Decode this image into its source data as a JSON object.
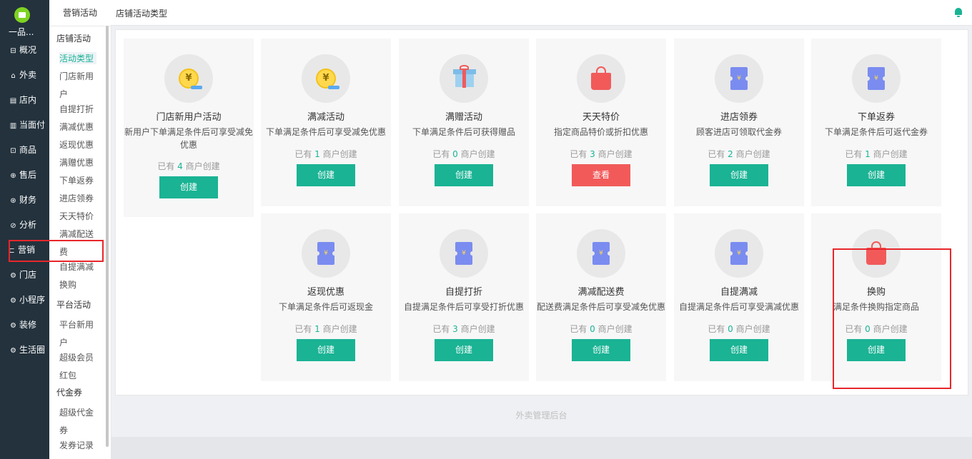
{
  "sidebar": {
    "logo_icon": "book-icon",
    "brand": "一品...",
    "items": [
      {
        "label": "概况",
        "icon": "dashboard-icon",
        "glyph": "⊟"
      },
      {
        "label": "外卖",
        "icon": "delivery-icon",
        "glyph": "⌂"
      },
      {
        "label": "店内",
        "icon": "store-icon",
        "glyph": "▤"
      },
      {
        "label": "当面付",
        "icon": "receipt-icon",
        "glyph": "▥"
      },
      {
        "label": "商品",
        "icon": "goods-icon",
        "glyph": "⊡"
      },
      {
        "label": "售后",
        "icon": "aftersale-icon",
        "glyph": "⊕"
      },
      {
        "label": "财务",
        "icon": "finance-icon",
        "glyph": "⊛"
      },
      {
        "label": "分析",
        "icon": "analysis-icon",
        "glyph": "⊘"
      },
      {
        "label": "营销",
        "icon": "marketing-icon",
        "glyph": "⊏"
      },
      {
        "label": "门店",
        "icon": "shop-icon",
        "glyph": "⚙"
      },
      {
        "label": "小程序",
        "icon": "miniapp-icon",
        "glyph": "⚙"
      },
      {
        "label": "装修",
        "icon": "decorate-icon",
        "glyph": "⚙"
      },
      {
        "label": "生活圈",
        "icon": "lifecircle-icon",
        "glyph": "⚙"
      }
    ]
  },
  "subnav": {
    "header": "营销活动",
    "group_store": "店铺活动",
    "item_activity_type": "活动类型",
    "item_new_user_1": "门店新用",
    "item_new_user_2": "户",
    "item_pickup_discount": "自提打折",
    "item_full_reduce": "满减优惠",
    "item_cashback": "返现优惠",
    "item_full_gift": "满赠优惠",
    "item_order_coupon": "下单返券",
    "item_enter_coupon": "进店领券",
    "item_daily_special": "天天特价",
    "item_delivery_fee_1": "满减配送",
    "item_delivery_fee_2": "费",
    "item_pickup_reduce": "自提满减",
    "item_exchange": "换购",
    "group_platform": "平台活动",
    "item_platform_new_1": "平台新用",
    "item_platform_new_2": "户",
    "item_super_member": "超级会员",
    "item_red_packet": "红包",
    "group_voucher": "代金券",
    "item_super_voucher_1": "超级代金",
    "item_super_voucher_2": "券",
    "item_issue_record": "发券记录"
  },
  "header": {
    "title": "店铺活动类型",
    "bell_icon": "bell-icon"
  },
  "cards": [
    {
      "title": "门店新用户活动",
      "desc": "新用户下单满足条件后可享受减免优惠",
      "count_prefix": "已有",
      "count": "4",
      "count_suffix": "商户创建",
      "button": "创建",
      "icon": "coin-icon"
    },
    {
      "title": "满减活动",
      "desc": "下单满足条件后可享受减免优惠",
      "count_prefix": "已有",
      "count": "1",
      "count_suffix": "商户创建",
      "button": "创建",
      "icon": "coin-icon"
    },
    {
      "title": "满赠活动",
      "desc": "下单满足条件后可获得赠品",
      "count_prefix": "已有",
      "count": "0",
      "count_suffix": "商户创建",
      "button": "创建",
      "icon": "gift-icon"
    },
    {
      "title": "天天特价",
      "desc": "指定商品特价或折扣优惠",
      "count_prefix": "已有",
      "count": "3",
      "count_suffix": "商户创建",
      "button": "查看",
      "icon": "shopping-bag-icon"
    },
    {
      "title": "进店领券",
      "desc": "顾客进店可领取代金券",
      "count_prefix": "已有",
      "count": "2",
      "count_suffix": "商户创建",
      "button": "创建",
      "icon": "voucher-icon"
    },
    {
      "title": "下单返券",
      "desc": "下单满足条件后可返代金券",
      "count_prefix": "已有",
      "count": "1",
      "count_suffix": "商户创建",
      "button": "创建",
      "icon": "voucher-icon"
    },
    {
      "title": "返现优惠",
      "desc": "下单满足条件后可返现金",
      "count_prefix": "已有",
      "count": "1",
      "count_suffix": "商户创建",
      "button": "创建",
      "icon": "voucher-icon"
    },
    {
      "title": "自提打折",
      "desc": "自提满足条件后可享受打折优惠",
      "count_prefix": "已有",
      "count": "3",
      "count_suffix": "商户创建",
      "button": "创建",
      "icon": "voucher-icon"
    },
    {
      "title": "满减配送费",
      "desc": "配送费满足条件后可享受减免优惠",
      "count_prefix": "已有",
      "count": "0",
      "count_suffix": "商户创建",
      "button": "创建",
      "icon": "voucher-icon"
    },
    {
      "title": "自提满减",
      "desc": "自提满足条件后可享受满减优惠",
      "count_prefix": "已有",
      "count": "0",
      "count_suffix": "商户创建",
      "button": "创建",
      "icon": "voucher-icon"
    },
    {
      "title": "换购",
      "desc": "满足条件换购指定商品",
      "count_prefix": "已有",
      "count": "0",
      "count_suffix": "商户创建",
      "button": "创建",
      "icon": "shopping-bag-icon"
    }
  ],
  "footer": {
    "text": "外卖管理后台"
  },
  "colors": {
    "accent": "#1ab394",
    "danger": "#f25a5a",
    "sidebar_bg": "#23323d",
    "highlight": "#e8262b"
  }
}
